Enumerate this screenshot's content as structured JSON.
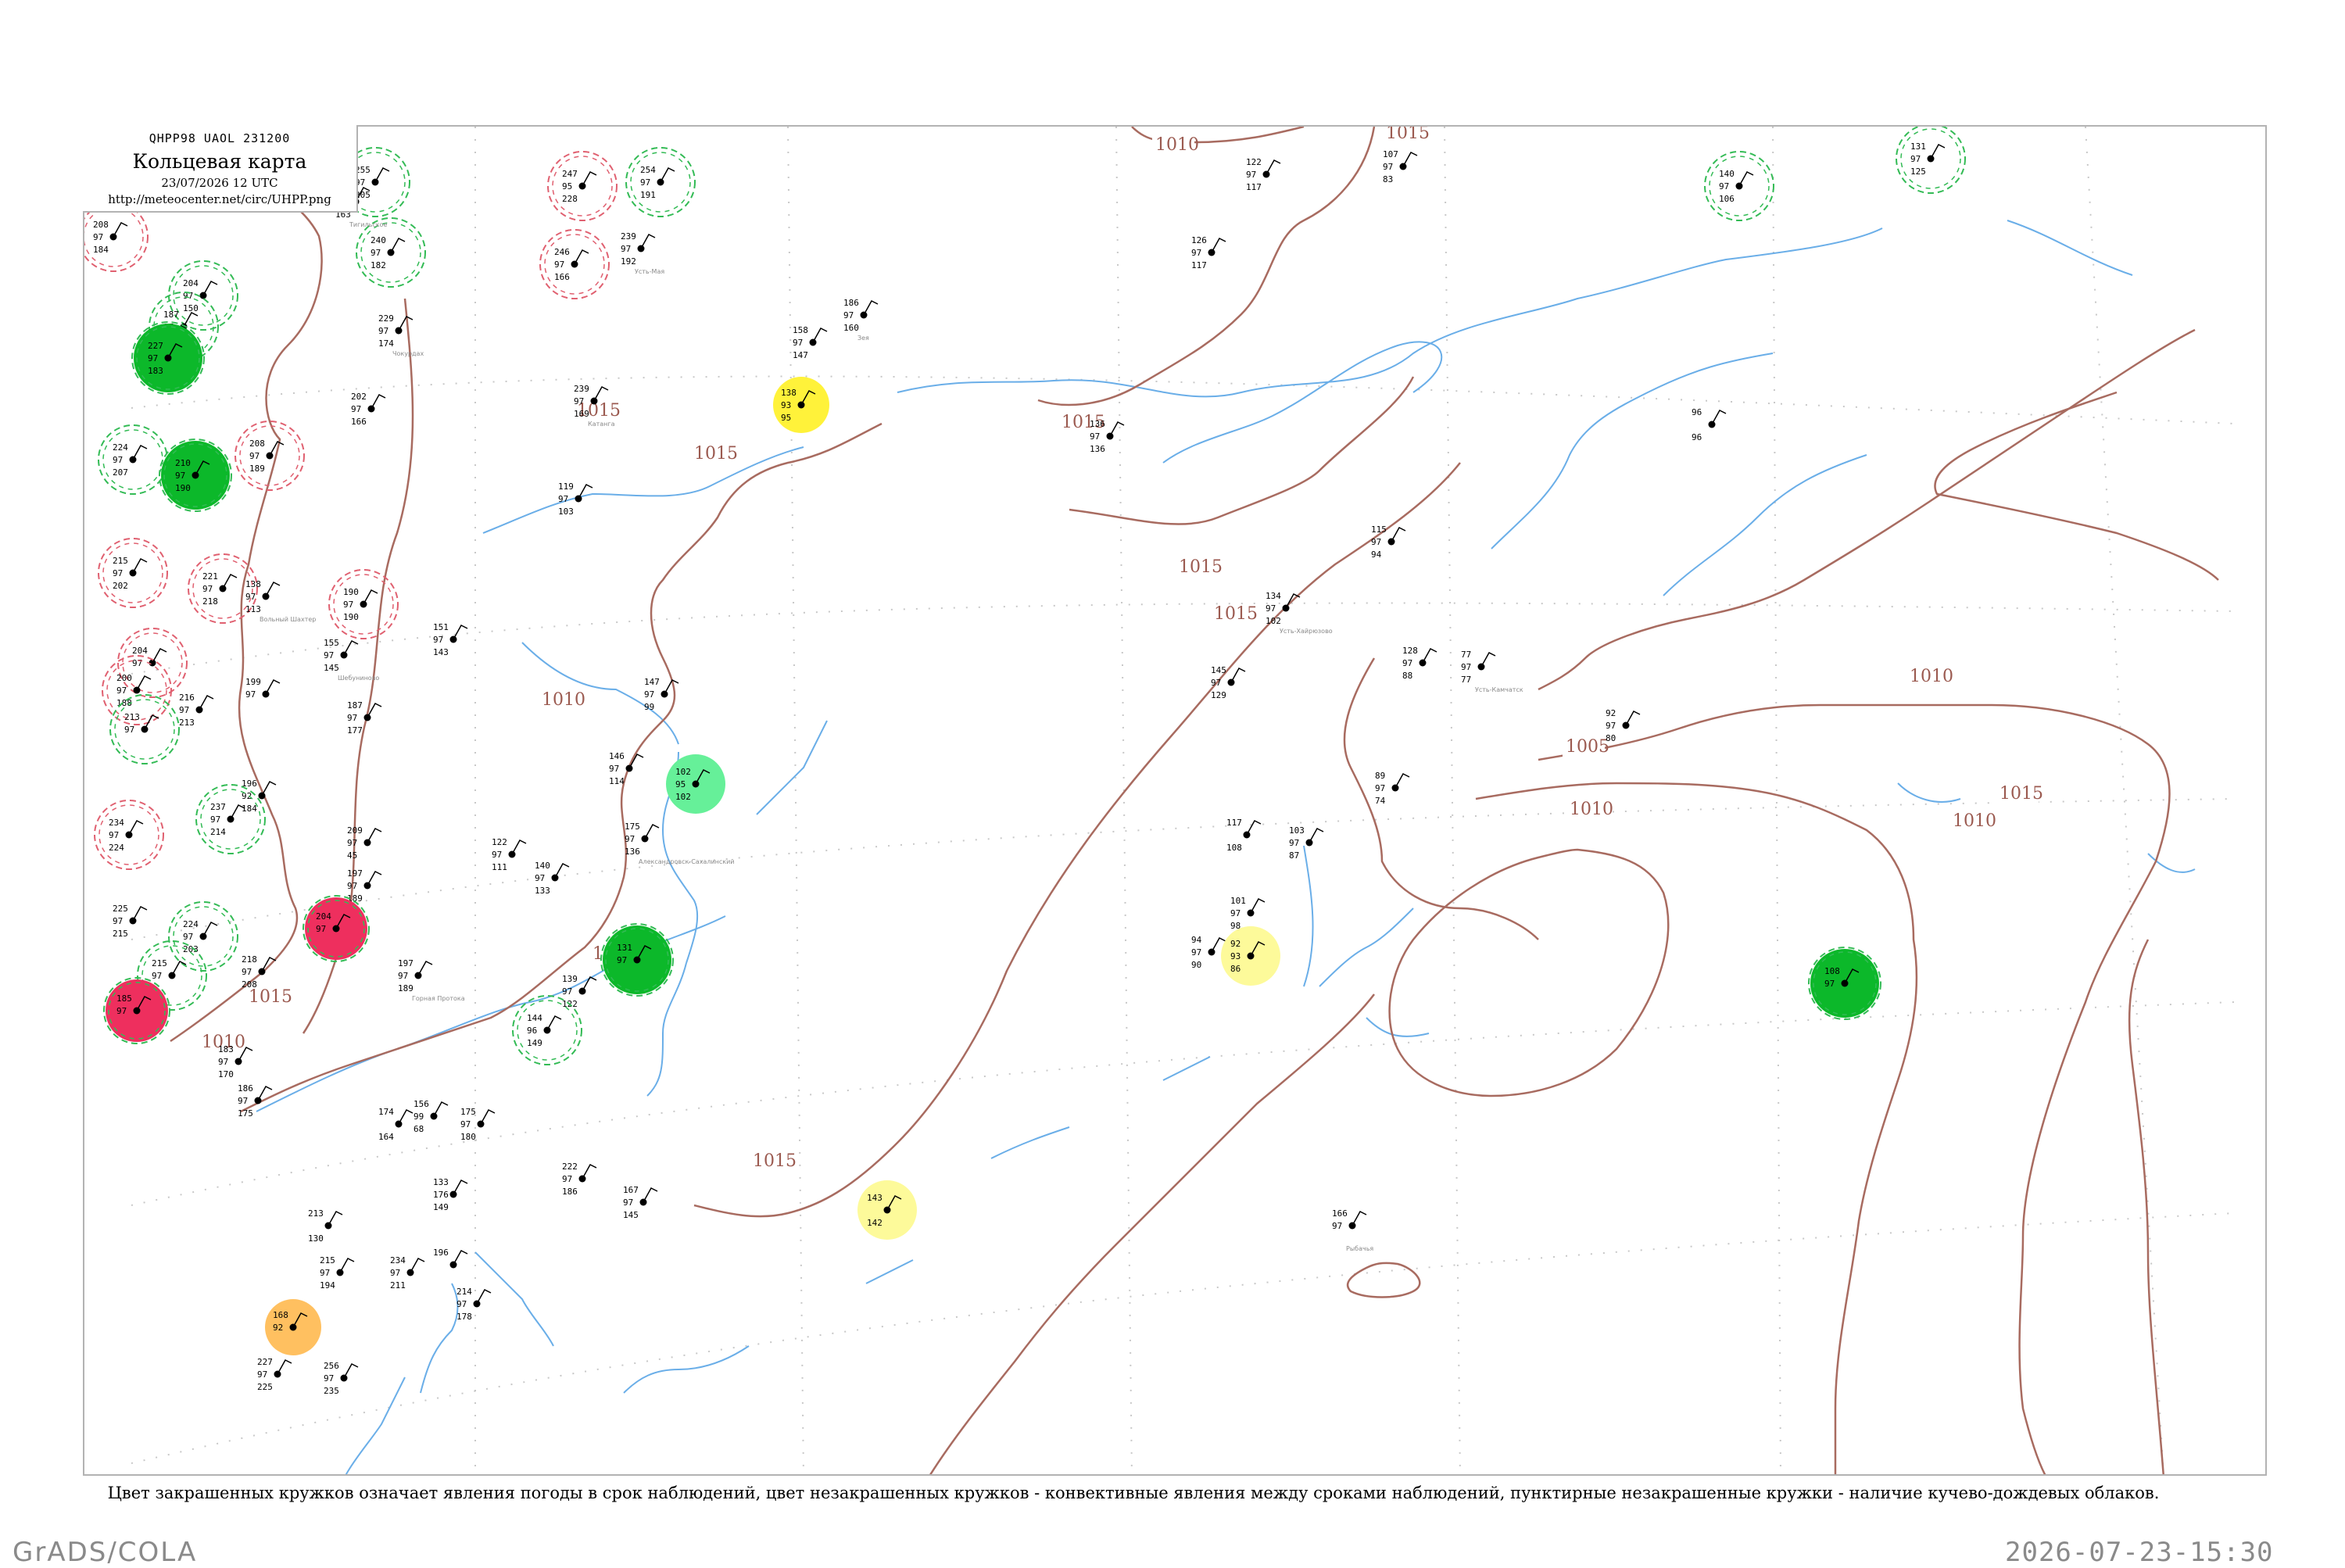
{
  "header": {
    "code": "QHPP98  UAOL  231200",
    "title": "Кольцевая карта",
    "date": "23/07/2026 12 UTC",
    "url": "http://meteocenter.net/circ/UHPP.png"
  },
  "caption": "Цвет закрашенных кружков означает явления погоды в срок наблюдений, цвет незакрашенных кружков - конвективные явления между сроками наблюдений, пунктирные незакрашенные кружки - наличие кучево-дождевых облаков.",
  "footer": {
    "left": "GrADS/COLA",
    "right": "2026-07-23-15:30"
  },
  "colors": {
    "isobar": "#a86b60",
    "coast": "#6aaee8",
    "rain_green": "#0cb82a",
    "shower_light_green": "#66f099",
    "fog_yellow": "#fff23a",
    "haze_light_yellow": "#fdfa9a",
    "thunder_orange": "#ffc060",
    "thunder_red": "#ee2f5e",
    "cb_dashed_green": "#33bb55",
    "thunder_ring_red": "#e06070"
  },
  "isobar_labels": [
    "1010",
    "1015",
    "1015",
    "1015",
    "1015",
    "1010",
    "1015",
    "1015",
    "1015",
    "1010",
    "1015",
    "1015",
    "1010",
    "1005",
    "1010",
    "1010",
    "1015"
  ],
  "stations": [
    {
      "p": "208",
      "t": "97",
      "d": "184",
      "n": "",
      "mark": "ring-red"
    },
    {
      "p": "255",
      "t": "97",
      "d": "205",
      "n": "",
      "mark": "ring-green"
    },
    {
      "p": "240",
      "t": "97",
      "d": "182",
      "n": "",
      "mark": "ring-green"
    },
    {
      "p": "215",
      "t": "97",
      "d": "163",
      "n": "Тигильское",
      "mark": "none"
    },
    {
      "p": "247",
      "t": "95",
      "d": "228",
      "n": "",
      "mark": "ring-red"
    },
    {
      "p": "246",
      "t": "97",
      "d": "166",
      "n": "",
      "mark": "ring-red"
    },
    {
      "p": "254",
      "t": "97",
      "d": "191",
      "n": "",
      "mark": "ring-green"
    },
    {
      "p": "239",
      "t": "97",
      "d": "192",
      "n": "Усть-Мая",
      "mark": "none"
    },
    {
      "p": "204",
      "t": "97",
      "d": "150",
      "n": "",
      "mark": "ring-green"
    },
    {
      "p": "187",
      "t": "97",
      "d": "172",
      "n": "",
      "mark": "ring-green"
    },
    {
      "p": "227",
      "t": "97",
      "d": "183",
      "n": "",
      "mark": "fill-green"
    },
    {
      "p": "229",
      "t": "97",
      "d": "174",
      "n": "Чокурдах",
      "mark": "none"
    },
    {
      "p": "202",
      "t": "97",
      "d": "166",
      "n": "",
      "mark": "none"
    },
    {
      "p": "239",
      "t": "97",
      "d": "169",
      "n": "Катанга",
      "mark": "none"
    },
    {
      "p": "224",
      "t": "97",
      "d": "207",
      "n": "",
      "mark": "ring-green"
    },
    {
      "p": "210",
      "t": "97",
      "d": "190",
      "n": "",
      "mark": "fill-green"
    },
    {
      "p": "208",
      "t": "97",
      "d": "189",
      "n": "",
      "mark": "ring-red"
    },
    {
      "p": "119",
      "t": "97",
      "d": "103",
      "n": "",
      "mark": "none"
    },
    {
      "p": "215",
      "t": "97",
      "d": "202",
      "n": "",
      "mark": "ring-red"
    },
    {
      "p": "221",
      "t": "97",
      "d": "218",
      "n": "",
      "mark": "ring-red"
    },
    {
      "p": "190",
      "t": "97",
      "d": "190",
      "n": "",
      "mark": "ring-red"
    },
    {
      "p": "138",
      "t": "97",
      "d": "113",
      "n": "Вольный Шахтер",
      "mark": "none"
    },
    {
      "p": "204",
      "t": "97",
      "d": "",
      "n": "",
      "mark": "ring-red"
    },
    {
      "p": "200",
      "t": "97",
      "d": "188",
      "n": "",
      "mark": "ring-red"
    },
    {
      "p": "213",
      "t": "97",
      "d": "",
      "n": "",
      "mark": "ring-green"
    },
    {
      "p": "216",
      "t": "97",
      "d": "213",
      "n": "",
      "mark": "none"
    },
    {
      "p": "199",
      "t": "97",
      "d": "",
      "n": "",
      "mark": "none"
    },
    {
      "p": "155",
      "t": "97",
      "d": "145",
      "n": "Шебуниново",
      "mark": "none"
    },
    {
      "p": "151",
      "t": "97",
      "d": "143",
      "n": "",
      "mark": "none"
    },
    {
      "p": "187",
      "t": "97",
      "d": "177",
      "n": "",
      "mark": "none"
    },
    {
      "p": "196",
      "t": "92",
      "d": "184",
      "n": "",
      "mark": "none"
    },
    {
      "p": "237",
      "t": "97",
      "d": "214",
      "n": "",
      "mark": "ring-green"
    },
    {
      "p": "234",
      "t": "97",
      "d": "224",
      "n": "",
      "mark": "ring-red"
    },
    {
      "p": "209",
      "t": "97",
      "d": "45",
      "n": "",
      "mark": "none"
    },
    {
      "p": "197",
      "t": "97",
      "d": "189",
      "n": "",
      "mark": "none"
    },
    {
      "p": "225",
      "t": "97",
      "d": "215",
      "n": "",
      "mark": "none"
    },
    {
      "p": "224",
      "t": "97",
      "d": "203",
      "n": "",
      "mark": "ring-green"
    },
    {
      "p": "218",
      "t": "97",
      "d": "208",
      "n": "",
      "mark": "none"
    },
    {
      "p": "215",
      "t": "97",
      "d": "",
      "n": "",
      "mark": "ring-green"
    },
    {
      "p": "204",
      "t": "97",
      "d": "",
      "n": "",
      "mark": "fill-red"
    },
    {
      "p": "185",
      "t": "97",
      "d": "",
      "n": "",
      "mark": "fill-red"
    },
    {
      "p": "138",
      "t": "93",
      "d": "95",
      "n": "",
      "mark": "fill-yellow"
    },
    {
      "p": "186",
      "t": "97",
      "d": "160",
      "n": "Зея",
      "mark": "none"
    },
    {
      "p": "158",
      "t": "97",
      "d": "147",
      "n": "",
      "mark": "none"
    },
    {
      "p": "122",
      "t": "97",
      "d": "117",
      "n": "",
      "mark": "none"
    },
    {
      "p": "107",
      "t": "97",
      "d": "83",
      "n": "",
      "mark": "none"
    },
    {
      "p": "126",
      "t": "97",
      "d": "117",
      "n": "",
      "mark": "none"
    },
    {
      "p": "140",
      "t": "97",
      "d": "106",
      "n": "",
      "mark": "ring-green"
    },
    {
      "p": "131",
      "t": "97",
      "d": "125",
      "n": "",
      "mark": "ring-green"
    },
    {
      "p": "136",
      "t": "97",
      "d": "136",
      "n": "",
      "mark": "none"
    },
    {
      "p": "96",
      "t": "",
      "d": "96",
      "n": "",
      "mark": "none"
    },
    {
      "p": "115",
      "t": "97",
      "d": "94",
      "n": "",
      "mark": "none"
    },
    {
      "p": "134",
      "t": "97",
      "d": "102",
      "n": "Усть-Хайрюзово",
      "mark": "none"
    },
    {
      "p": "128",
      "t": "97",
      "d": "88",
      "n": "",
      "mark": "none"
    },
    {
      "p": "77",
      "t": "97",
      "d": "77",
      "n": "Усть-Камчатск",
      "mark": "none"
    },
    {
      "p": "92",
      "t": "97",
      "d": "80",
      "n": "",
      "mark": "none"
    },
    {
      "p": "145",
      "t": "97",
      "d": "129",
      "n": "",
      "mark": "none"
    },
    {
      "p": "89",
      "t": "97",
      "d": "74",
      "n": "",
      "mark": "none"
    },
    {
      "p": "117",
      "t": "",
      "d": "108",
      "n": "",
      "mark": "none"
    },
    {
      "p": "103",
      "t": "97",
      "d": "87",
      "n": "",
      "mark": "none"
    },
    {
      "p": "101",
      "t": "97",
      "d": "98",
      "n": "",
      "mark": "none"
    },
    {
      "p": "94",
      "t": "97",
      "d": "90",
      "n": "",
      "mark": "none"
    },
    {
      "p": "92",
      "t": "93",
      "d": "86",
      "n": "",
      "mark": "fill-lightyellow"
    },
    {
      "p": "108",
      "t": "97",
      "d": "",
      "n": "",
      "mark": "fill-green"
    },
    {
      "p": "147",
      "t": "97",
      "d": "99",
      "n": "",
      "mark": "none"
    },
    {
      "p": "146",
      "t": "97",
      "d": "114",
      "n": "",
      "mark": "none"
    },
    {
      "p": "102",
      "t": "95",
      "d": "102",
      "n": "",
      "mark": "fill-lightgreen"
    },
    {
      "p": "175",
      "t": "97",
      "d": "136",
      "n": "Александровск-Сахалинский",
      "mark": "none"
    },
    {
      "p": "122",
      "t": "97",
      "d": "111",
      "n": "",
      "mark": "none"
    },
    {
      "p": "140",
      "t": "97",
      "d": "133",
      "n": "",
      "mark": "none"
    },
    {
      "p": "131",
      "t": "97",
      "d": "",
      "n": "",
      "mark": "fill-green"
    },
    {
      "p": "139",
      "t": "97",
      "d": "122",
      "n": "",
      "mark": "none"
    },
    {
      "p": "144",
      "t": "96",
      "d": "149",
      "n": "",
      "mark": "ring-green"
    },
    {
      "p": "183",
      "t": "97",
      "d": "170",
      "n": "",
      "mark": "none"
    },
    {
      "p": "186",
      "t": "97",
      "d": "175",
      "n": "",
      "mark": "none"
    },
    {
      "p": "197",
      "t": "97",
      "d": "189",
      "n": "Горная Протока",
      "mark": "none"
    },
    {
      "p": "174",
      "t": "",
      "d": "164",
      "n": "",
      "mark": "none"
    },
    {
      "p": "156",
      "t": "99",
      "d": "68",
      "n": "",
      "mark": "none"
    },
    {
      "p": "175",
      "t": "97",
      "d": "180",
      "n": "",
      "mark": "none"
    },
    {
      "p": "133",
      "t": "176",
      "d": "149",
      "n": "",
      "mark": "none"
    },
    {
      "p": "222",
      "t": "97",
      "d": "186",
      "n": "",
      "mark": "none"
    },
    {
      "p": "167",
      "t": "97",
      "d": "145",
      "n": "",
      "mark": "none"
    },
    {
      "p": "143",
      "t": "",
      "d": "142",
      "n": "",
      "mark": "fill-lightyellow"
    },
    {
      "p": "166",
      "t": "97",
      "d": "",
      "n": "Рыбачья",
      "mark": "none"
    },
    {
      "p": "213",
      "t": "",
      "d": "130",
      "n": "",
      "mark": "none"
    },
    {
      "p": "215",
      "t": "97",
      "d": "194",
      "n": "",
      "mark": "none"
    },
    {
      "p": "234",
      "t": "97",
      "d": "211",
      "n": "",
      "mark": "none"
    },
    {
      "p": "196",
      "t": "",
      "d": "",
      "n": "",
      "mark": "none"
    },
    {
      "p": "214",
      "t": "97",
      "d": "178",
      "n": "",
      "mark": "none"
    },
    {
      "p": "168",
      "t": "92",
      "d": "",
      "n": "",
      "mark": "fill-orange"
    },
    {
      "p": "227",
      "t": "97",
      "d": "225",
      "n": "",
      "mark": "none"
    },
    {
      "p": "256",
      "t": "97",
      "d": "235",
      "n": "",
      "mark": "none"
    },
    {
      "p": "244",
      "t": "97",
      "d": "",
      "n": "",
      "mark": "fill-green"
    }
  ]
}
